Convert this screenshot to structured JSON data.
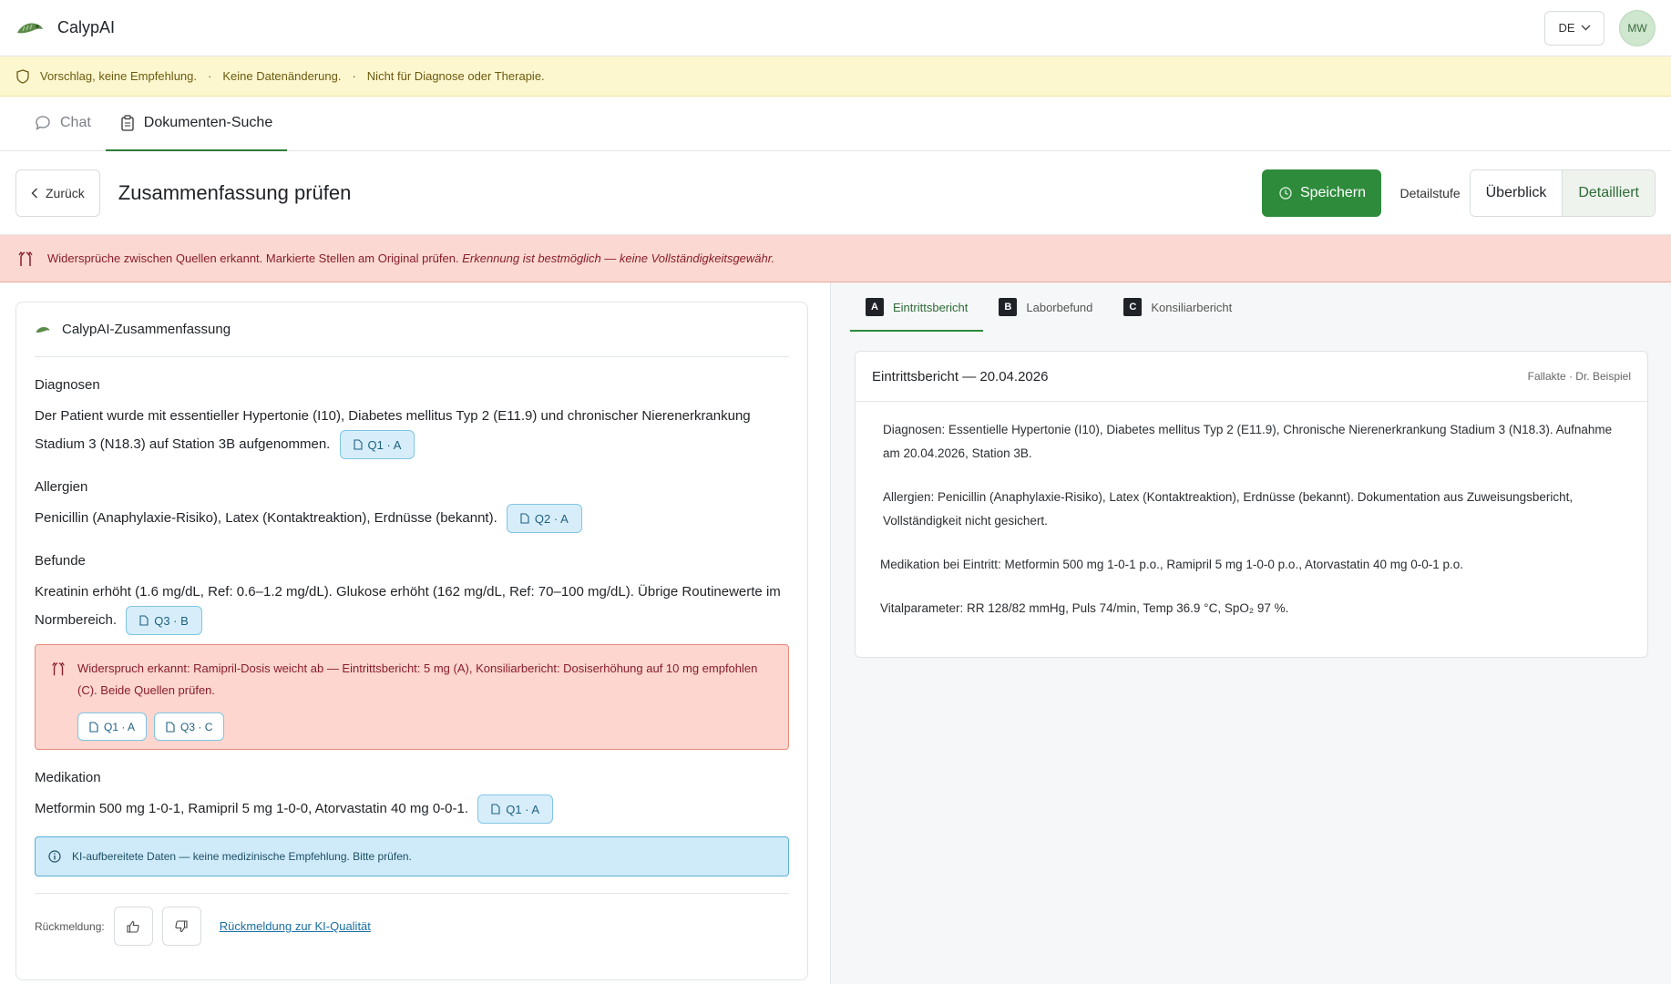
{
  "app": {
    "title": "CalypAI",
    "lang": "DE",
    "avatar_initials": "MW"
  },
  "notice": {
    "parts": [
      "Vorschlag, keine Empfehlung.",
      "Keine Datenänderung.",
      "Nicht für Diagnose oder Therapie."
    ]
  },
  "tabs": [
    {
      "label": "Chat",
      "active": false
    },
    {
      "label": "Dokumenten-Suche",
      "active": true
    }
  ],
  "toolbar": {
    "back_label": "Zurück",
    "title": "Zusammenfassung prüfen",
    "save_label": "Speichern",
    "detail_label": "Detailstufe",
    "detail_options": [
      "Überblick",
      "Detailliert"
    ],
    "detail_selected": "Detailliert"
  },
  "contradiction_banner": {
    "text": "Widersprüche zwischen Quellen erkannt. Markierte Stellen am Original prüfen.",
    "note": "Erkennung ist bestmöglich — keine Vollständigkeitsgewähr."
  },
  "summary": {
    "header": "CalypAI-Zusammenfassung",
    "sections": {
      "diagnosen": {
        "title": "Diagnosen",
        "text": "Der Patient wurde mit essentieller Hypertonie (I10), Diabetes mellitus Typ 2 (E11.9) und chronischer Nierenerkrankung Stadium 3 (N18.3) auf Station 3B aufgenommen.",
        "chip": "Q1 · A"
      },
      "allergien": {
        "title": "Allergien",
        "text": "Penicillin (Anaphylaxie-Risiko), Latex (Kontaktreaktion), Erdnüsse (bekannt).",
        "chip": "Q2 · A"
      },
      "befunde": {
        "title": "Befunde",
        "text": "Kreatinin erhöht (1.6 mg/dL, Ref: 0.6–1.2 mg/dL). Glukose erhöht (162 mg/dL, Ref: 70–100 mg/dL). Übrige Routinewerte im Normbereich.",
        "chip": "Q3 · B"
      },
      "medikation": {
        "title": "Medikation",
        "text": "Metformin 500 mg 1-0-1, Ramipril 5 mg 1-0-0, Atorvastatin 40 mg 0-0-1.",
        "chip": "Q1 · A"
      }
    },
    "contradiction": {
      "text": "Widerspruch erkannt: Ramipril-Dosis weicht ab — Eintrittsbericht: 5 mg (A), Konsiliarbericht: Dosiserhöhung auf 10 mg empfohlen (C). Beide Quellen prüfen.",
      "chips": [
        "Q1 · A",
        "Q3 · C"
      ]
    },
    "info": "KI-aufbereitete Daten — keine medizinische Empfehlung. Bitte prüfen.",
    "feedback_label": "Rückmeldung:",
    "feedback_link": "Rückmeldung zur KI-Qualität"
  },
  "documents": {
    "tabs": [
      {
        "letter": "A",
        "label": "Eintrittsbericht",
        "active": true
      },
      {
        "letter": "B",
        "label": "Laborbefund",
        "active": false
      },
      {
        "letter": "C",
        "label": "Konsiliarbericht",
        "active": false
      }
    ],
    "card": {
      "title": "Eintrittsbericht — 20.04.2026",
      "meta": "Fallakte · Dr. Beispiel",
      "paragraphs": [
        "Diagnosen: Essentielle Hypertonie (I10), Diabetes mellitus Typ 2 (E11.9), Chronische Nierenerkrankung Stadium 3 (N18.3). Aufnahme am 20.04.2026, Station 3B.",
        "Allergien: Penicillin (Anaphylaxie-Risiko), Latex (Kontaktreaktion), Erdnüsse (bekannt). Dokumentation aus Zuweisungsbericht, Vollständigkeit nicht gesichert.",
        "Medikation bei Eintritt: Metformin 500 mg 1-0-1 p.o., Ramipril 5 mg 1-0-0 p.o., Atorvastatin 40 mg 0-0-1 p.o.",
        "Vitalparameter: RR 128/82 mmHg, Puls 74/min, Temp 36.9 °C, SpO₂ 97 %."
      ]
    }
  },
  "colors": {
    "accent": "#2e8b3c",
    "warning_bg": "#fbd9d2",
    "notice_bg": "#fdf7cf",
    "chip_bg": "#d7eefa"
  }
}
